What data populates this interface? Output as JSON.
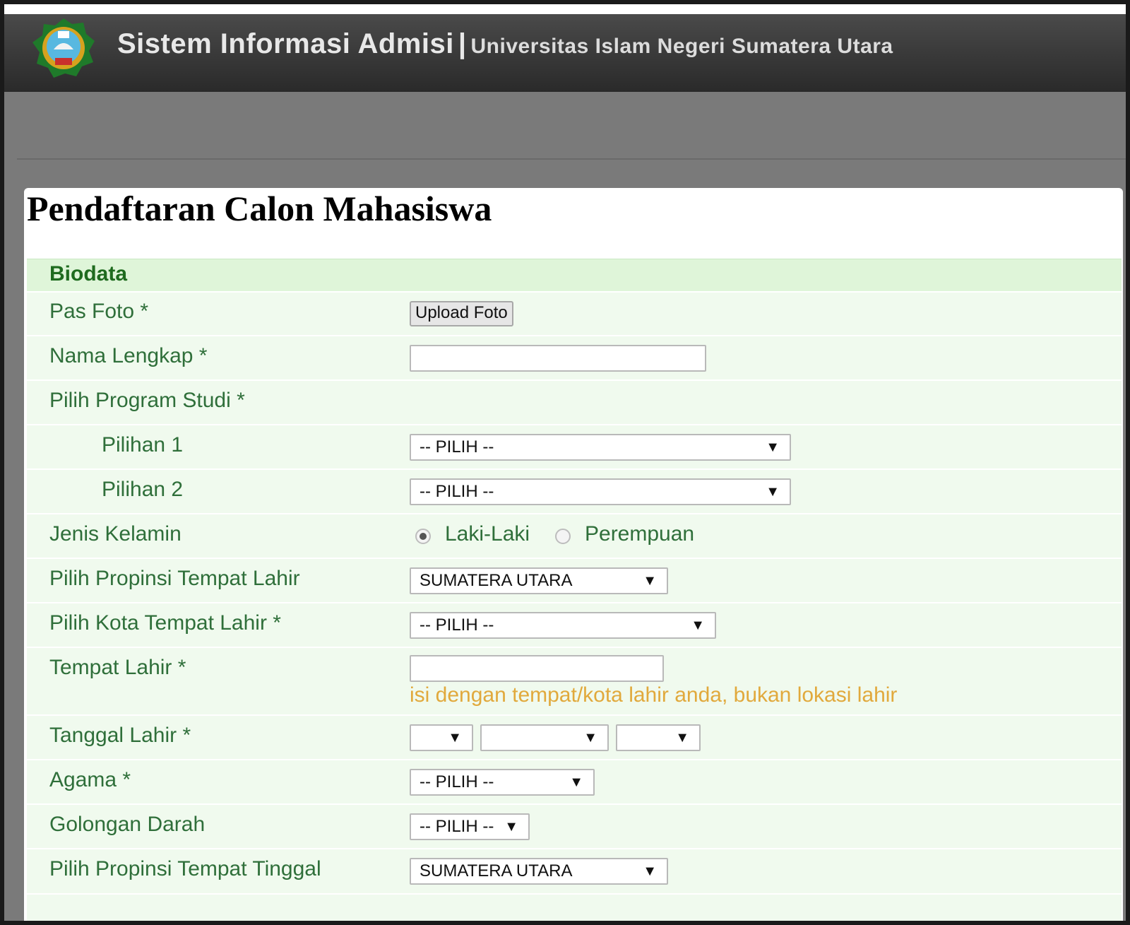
{
  "header": {
    "app_title": "Sistem Informasi Admisi",
    "separator": "|",
    "institution": "Universitas Islam Negeri Sumatera Utara",
    "logo_icon": "university-crest-icon"
  },
  "page": {
    "title": "Pendaftaran Calon Mahasiswa"
  },
  "form": {
    "section": "Biodata",
    "pas_foto": {
      "label": "Pas Foto *",
      "button": "Upload Foto"
    },
    "nama_lengkap": {
      "label": "Nama Lengkap *",
      "value": ""
    },
    "program_studi": {
      "label": "Pilih Program Studi *"
    },
    "pilihan1": {
      "label": "Pilihan 1",
      "value": "-- PILIH --"
    },
    "pilihan2": {
      "label": "Pilihan 2",
      "value": "-- PILIH --"
    },
    "jenis_kelamin": {
      "label": "Jenis Kelamin",
      "option1": "Laki-Laki",
      "option2": "Perempuan",
      "selected": "Laki-Laki"
    },
    "propinsi_lahir": {
      "label": "Pilih Propinsi Tempat Lahir",
      "value": "SUMATERA UTARA"
    },
    "kota_lahir": {
      "label": "Pilih Kota Tempat Lahir *",
      "value": "-- PILIH --"
    },
    "tempat_lahir": {
      "label": "Tempat Lahir *",
      "value": "",
      "hint": "isi dengan tempat/kota lahir anda, bukan lokasi lahir"
    },
    "tanggal_lahir": {
      "label": "Tanggal Lahir *",
      "day": "",
      "month": "",
      "year": ""
    },
    "agama": {
      "label": "Agama *",
      "value": "-- PILIH --"
    },
    "golongan_darah": {
      "label": "Golongan Darah",
      "value": "-- PILIH --"
    },
    "propinsi_tinggal": {
      "label": "Pilih Propinsi Tempat Tinggal",
      "value": "SUMATERA UTARA"
    }
  },
  "colors": {
    "header_bg": "#333333",
    "section_bg": "#dff5d9",
    "row_bg": "#f0faee",
    "label_text": "#2f6f3a",
    "hint_text": "#e1a93c"
  }
}
